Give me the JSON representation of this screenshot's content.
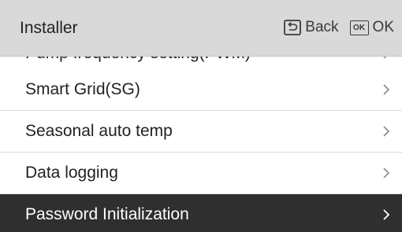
{
  "header": {
    "title": "Installer",
    "back_label": "Back",
    "ok_icon_text": "OK",
    "ok_label": "OK"
  },
  "menu": {
    "items": [
      {
        "label": "Pump frequency setting(PWM)",
        "icon": "chevron-right-icon",
        "selected": false
      },
      {
        "label": "Smart Grid(SG)",
        "icon": "chevron-right-icon",
        "selected": false
      },
      {
        "label": "Seasonal auto temp",
        "icon": "chevron-right-icon",
        "selected": false
      },
      {
        "label": "Data logging",
        "icon": "chevron-right-icon",
        "selected": false
      },
      {
        "label": "Password Initialization",
        "icon": "chevron-right-icon",
        "selected": true
      }
    ]
  },
  "colors": {
    "header_bg": "#d9d9d9",
    "selected_bg": "#2f2f2f",
    "divider": "#d9d9d9"
  }
}
